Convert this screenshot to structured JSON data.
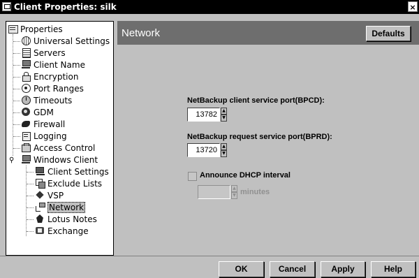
{
  "window": {
    "title": "Client Properties: silk",
    "close_symbol": "×"
  },
  "tree": {
    "root": "Properties",
    "items": [
      {
        "label": "Universal Settings",
        "icon": "globe-icon"
      },
      {
        "label": "Servers",
        "icon": "server-icon"
      },
      {
        "label": "Client Name",
        "icon": "computer-icon"
      },
      {
        "label": "Encryption",
        "icon": "lock-icon"
      },
      {
        "label": "Port Ranges",
        "icon": "target-icon"
      },
      {
        "label": "Timeouts",
        "icon": "clock-icon"
      },
      {
        "label": "GDM",
        "icon": "gdm-icon"
      },
      {
        "label": "Firewall",
        "icon": "firewall-icon"
      },
      {
        "label": "Logging",
        "icon": "logging-icon"
      },
      {
        "label": "Access Control",
        "icon": "access-control-icon"
      },
      {
        "label": "Windows Client",
        "icon": "computer-icon"
      }
    ],
    "windows_children": [
      {
        "label": "Client Settings",
        "icon": "computer-icon"
      },
      {
        "label": "Exclude Lists",
        "icon": "exclude-list-icon"
      },
      {
        "label": "VSP",
        "icon": "vsp-icon"
      },
      {
        "label": "Network",
        "icon": "network-icon",
        "selected": true
      },
      {
        "label": "Lotus Notes",
        "icon": "lotus-notes-icon"
      },
      {
        "label": "Exchange",
        "icon": "exchange-icon"
      }
    ]
  },
  "panel": {
    "title": "Network",
    "defaults_label": "Defaults",
    "bpcd_label": "NetBackup client service port(BPCD):",
    "bpcd_value": "13782",
    "bprd_label": "NetBackup request service port(BPRD):",
    "bprd_value": "13720",
    "dhcp_label": "Announce DHCP interval",
    "dhcp_checked": false,
    "dhcp_value": "",
    "dhcp_unit": "minutes"
  },
  "footer": {
    "ok_label": "OK",
    "cancel_label": "Cancel",
    "apply_label": "Apply",
    "help_label": "Help"
  },
  "colors": {
    "header_bg": "#6e6e6e",
    "panel_bg": "#c0c0c0",
    "titlebar_bg": "#000000"
  }
}
